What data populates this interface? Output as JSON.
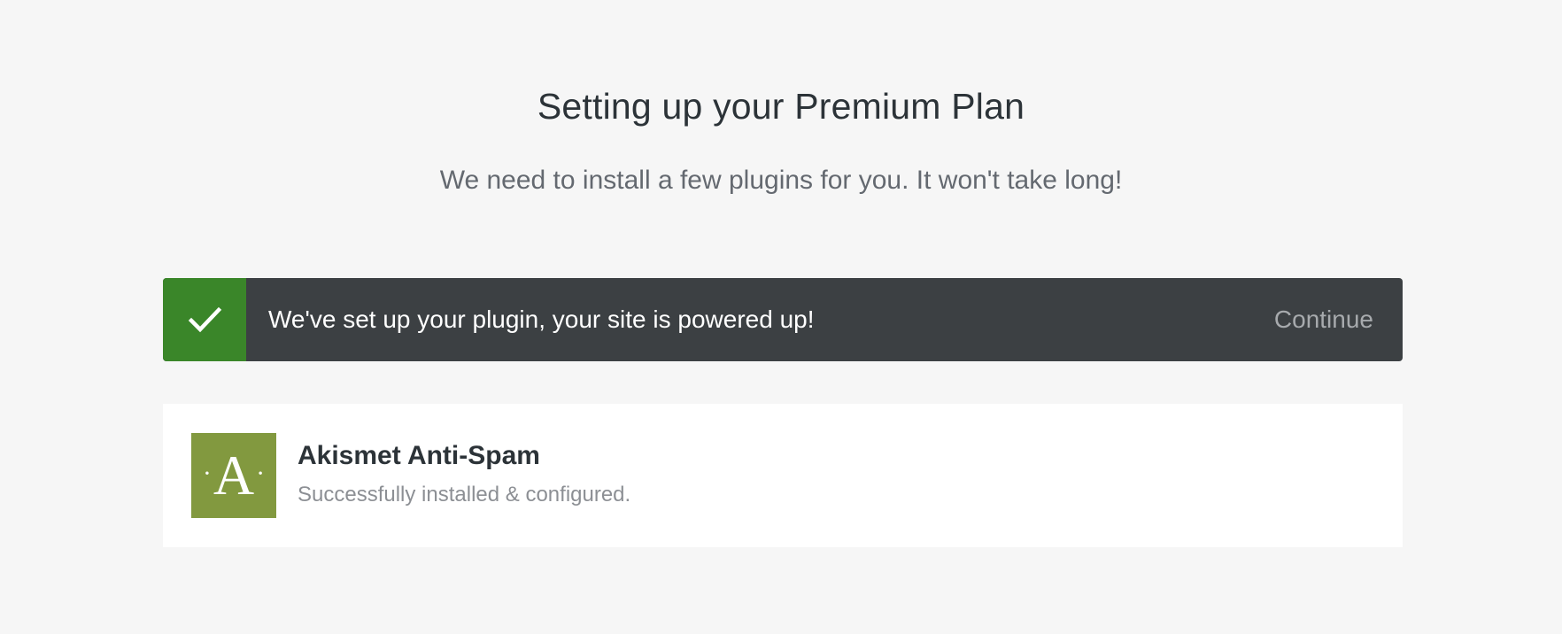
{
  "header": {
    "title": "Setting up your Premium Plan",
    "subtitle": "We need to install a few plugins for you. It won't take long!"
  },
  "notice": {
    "icon": "checkmark-icon",
    "message": "We've set up your plugin, your site is powered up!",
    "action_label": "Continue",
    "colors": {
      "background": "#3c4043",
      "icon_background": "#3a8629"
    }
  },
  "plugins": [
    {
      "logo_letter": "A",
      "name": "Akismet Anti-Spam",
      "status": "Successfully installed & configured.",
      "logo_color": "#82993f"
    }
  ]
}
